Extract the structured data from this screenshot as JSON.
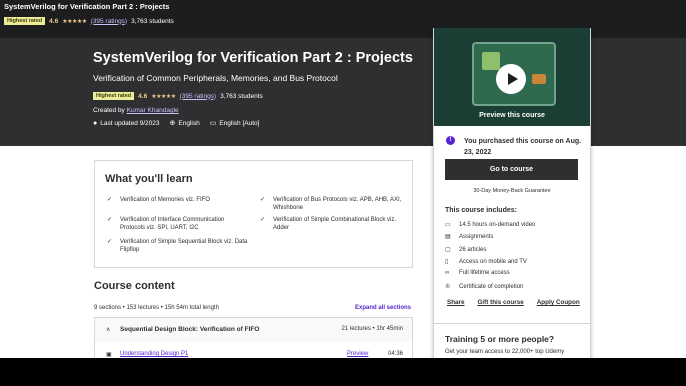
{
  "topbar": {
    "title": "SystemVerilog for Verification Part 2 : Projects",
    "badge": "Highest rated",
    "rating": "4.6",
    "stars": "★★★★★",
    "ratings_link": "(395 ratings)",
    "students": "3,763 students"
  },
  "hero": {
    "title": "SystemVerilog for Verification Part 2 : Projects",
    "subtitle": "Verification of Common Peripherals, Memories, and Bus Protocol",
    "badge": "Highest rated",
    "rating": "4.6",
    "stars": "★★★★★",
    "ratings_link": "(395 ratings)",
    "students": "3,763 students",
    "created_by_label": "Created by",
    "author": "Kumar Khandagle",
    "last_updated": "Last updated 9/2023",
    "language": "English",
    "captions": "English [Auto]"
  },
  "learn": {
    "heading": "What you'll learn",
    "items": [
      "Verification of Memories viz. FIFO",
      "Verification of Bus Protocols viz. APB, AHB, AXI, Whishbone",
      "Verification of Interface Communication Protocols viz. SPI, UART, I2C",
      "Verification of Simple Combinational Block viz. Adder",
      "Verification of Simple Sequential Block viz. Data Flipflop"
    ]
  },
  "content": {
    "heading": "Course content",
    "summary": "9 sections • 153 lectures • 15h 54m total length",
    "expand": "Expand all sections",
    "section_title": "Sequential Design Block: Verification of FIFO",
    "section_meta": "21 lectures • 1hr 45min",
    "lecture_title": "Understanding Design P1",
    "lecture_preview": "Preview",
    "lecture_duration": "04:36"
  },
  "card": {
    "preview_label": "Preview this course",
    "purchased": "You purchased this course on Aug. 23, 2022",
    "go_button": "Go to course",
    "guarantee": "30-Day Money-Back Guarantee",
    "includes_heading": "This course includes:",
    "includes": [
      "14.5 hours on-demand video",
      "Assignments",
      "26 articles",
      "Access on mobile and TV",
      "Full lifetime access",
      "Certificate of completion"
    ],
    "share": "Share",
    "gift": "Gift this course",
    "coupon": "Apply Coupon",
    "training_heading": "Training 5 or more people?",
    "training_sub": "Get your team access to 22,000+ top Udemy"
  },
  "colors": {
    "dark_bg": "#1c1d1f",
    "hero_bg": "#2d2f31",
    "accent": "#5624d0",
    "star": "#f3ca8c",
    "badge_bg": "#eceb98"
  }
}
